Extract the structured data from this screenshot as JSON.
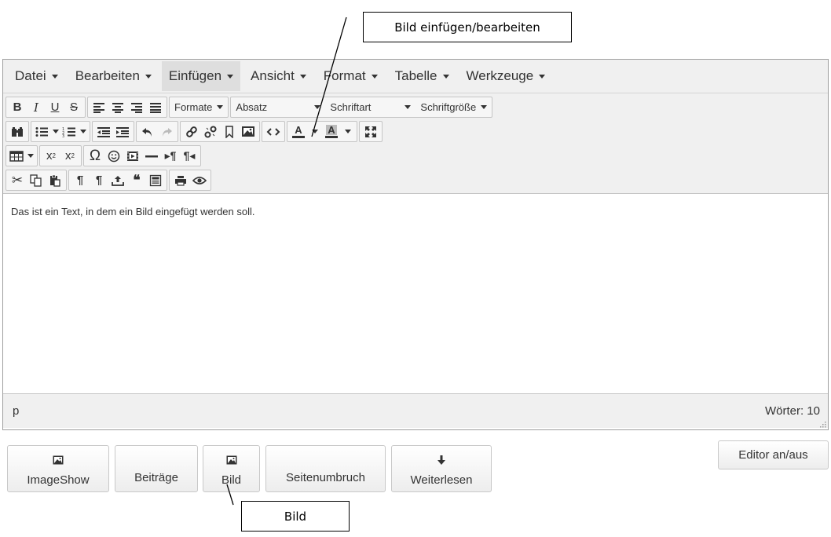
{
  "annotations": {
    "top_label": "Bild einfügen/bearbeiten",
    "bottom_label": "Bild"
  },
  "menubar": {
    "items": [
      {
        "label": "Datei"
      },
      {
        "label": "Bearbeiten"
      },
      {
        "label": "Einfügen",
        "active": true
      },
      {
        "label": "Ansicht"
      },
      {
        "label": "Format"
      },
      {
        "label": "Tabelle"
      },
      {
        "label": "Werkzeuge"
      }
    ]
  },
  "toolbar": {
    "bold": "B",
    "italic": "I",
    "underline": "U",
    "strikethrough": "S",
    "formats": "Formate",
    "block": "Absatz",
    "font": "Schriftart",
    "size": "Schriftgröße",
    "omega": "Ω",
    "subscript": "x",
    "superscript": "x",
    "text_color": "A",
    "bg_color": "A"
  },
  "content": {
    "text": "Das ist ein Text, in dem ein Bild eingefügt werden soll."
  },
  "statusbar": {
    "path": "p",
    "wordcount": "Wörter: 10"
  },
  "extra_buttons": {
    "imageshow": "ImageShow",
    "beitraege": "Beiträge",
    "bild": "Bild",
    "seitenumbruch": "Seitenumbruch",
    "weiterlesen": "Weiterlesen",
    "editor_toggle": "Editor an/aus"
  },
  "icons": [
    "bold-icon",
    "italic-icon",
    "underline-icon",
    "strikethrough-icon",
    "align-left-icon",
    "align-center-icon",
    "align-right-icon",
    "align-justify-icon",
    "find-icon",
    "bullet-list-icon",
    "numbered-list-icon",
    "outdent-icon",
    "indent-icon",
    "undo-icon",
    "redo-icon",
    "link-icon",
    "unlink-icon",
    "anchor-icon",
    "image-icon",
    "code-icon",
    "fullscreen-icon",
    "table-icon",
    "omega-icon",
    "emoticon-icon",
    "media-icon",
    "hr-icon",
    "ltr-icon",
    "rtl-icon",
    "cut-icon",
    "copy-icon",
    "paste-icon",
    "pilcrow-icon",
    "visualblocks-icon",
    "upload-icon",
    "blockquote-icon",
    "template-icon",
    "print-icon",
    "preview-icon",
    "arrow-down-icon"
  ]
}
